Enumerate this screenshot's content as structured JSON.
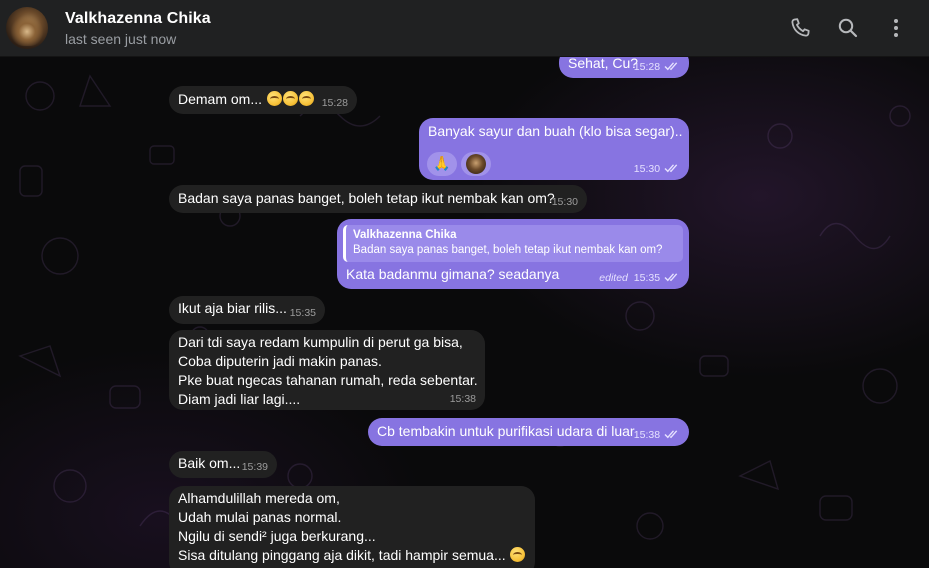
{
  "header": {
    "title": "Valkhazenna Chika",
    "status": "last seen just now",
    "icons": [
      "phone-icon",
      "search-icon",
      "more-vertical-icon"
    ]
  },
  "colors": {
    "incoming_bubble": "#212121",
    "outgoing_bubble": "#8774e1",
    "header_bg": "#202122"
  },
  "messages": [
    {
      "dir": "out",
      "text": "Sehat, Cu?",
      "time": "15:28",
      "ticks": "double"
    },
    {
      "dir": "in",
      "text": "Demam om...",
      "emoji_count": 3,
      "time": "15:28"
    },
    {
      "dir": "out",
      "text": "Banyak sayur dan buah (klo bisa segar)..",
      "reactions": [
        "🙏",
        "avatar"
      ],
      "time": "15:30",
      "ticks": "double"
    },
    {
      "dir": "in",
      "text": "Badan saya panas banget, boleh tetap ikut nembak kan om?",
      "time": "15:30"
    },
    {
      "dir": "out",
      "reply_name": "Valkhazenna Chika",
      "reply_text": "Badan saya panas banget, boleh tetap ikut nembak kan om?",
      "text": "Kata badanmu gimana? seadanya",
      "edited": "edited",
      "time": "15:35",
      "ticks": "double"
    },
    {
      "dir": "in",
      "text": "Ikut aja biar rilis...",
      "time": "15:35"
    },
    {
      "dir": "in",
      "text": "Dari tdi saya redam kumpulin di perut ga bisa,\nCoba diputerin jadi makin panas.\nPke buat ngecas tahanan rumah, reda sebentar.\nDiam jadi liar lagi....",
      "time": "15:38"
    },
    {
      "dir": "out",
      "text": "Cb tembakin untuk purifikasi udara di luar",
      "time": "15:38",
      "ticks": "double"
    },
    {
      "dir": "in",
      "text": "Baik om...",
      "time": "15:39"
    },
    {
      "dir": "in",
      "text": "Alhamdulillah mereda om,\nUdah mulai panas normal.\nNgilu di sendi² juga berkurang...\nSisa ditulang pinggang aja dikit, tadi hampir semua...",
      "emoji_count": 1,
      "time": ""
    }
  ]
}
